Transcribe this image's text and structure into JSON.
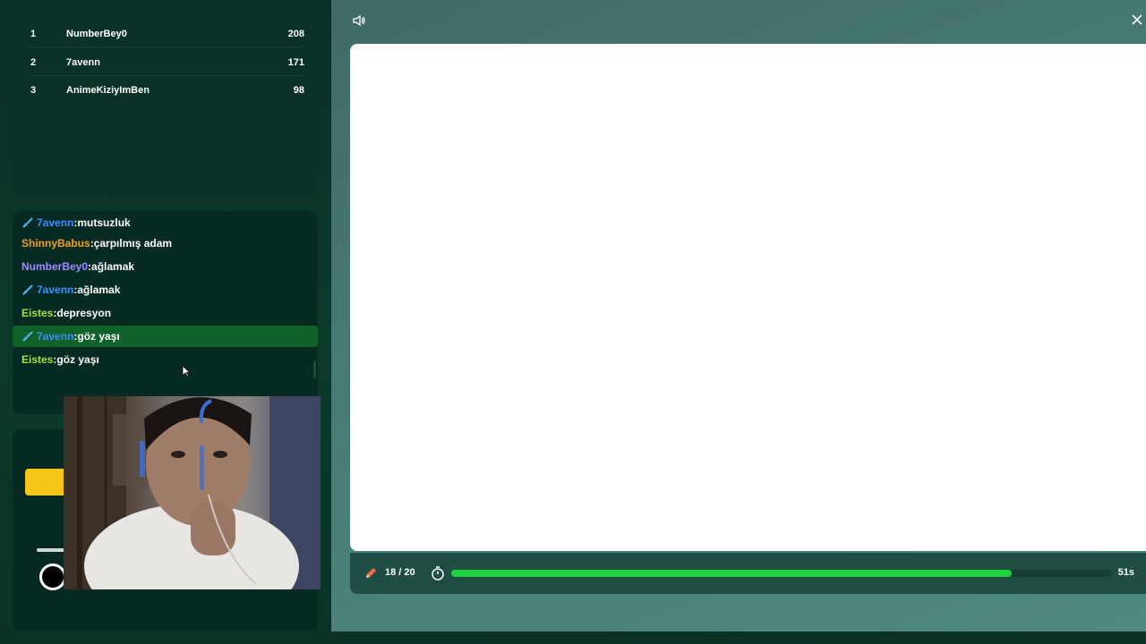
{
  "leaderboard": {
    "rows": [
      {
        "rank": "1",
        "name": "NumberBey0",
        "score": "208"
      },
      {
        "rank": "2",
        "name": "7avenn",
        "score": "171"
      },
      {
        "rank": "3",
        "name": "AnimeKiziyImBen",
        "score": "98"
      }
    ]
  },
  "chat": {
    "messages": [
      {
        "user": "7avenn",
        "sep": ":",
        "text": "mutsuzluk",
        "user_color": "#3a8dff",
        "badge": "sword-icon"
      },
      {
        "user": "ShinnyBabus",
        "sep": ":",
        "text": "çarpılmış adam",
        "user_color": "#f0a020",
        "badge": ""
      },
      {
        "user": "NumberBey0",
        "sep": ":",
        "text": "ağlamak",
        "user_color": "#9c8cff",
        "badge": ""
      },
      {
        "user": "7avenn",
        "sep": ":",
        "text": "ağlamak",
        "user_color": "#3a8dff",
        "badge": "sword-icon"
      },
      {
        "user": "Eistes",
        "sep": ":",
        "text": "depresyon",
        "user_color": "#a6e22e",
        "badge": ""
      },
      {
        "user": "7avenn",
        "sep": ":",
        "text": "göz yaşı",
        "user_color": "#3a8dff",
        "badge": "sword-icon",
        "highlight": true
      },
      {
        "user": "Eistes",
        "sep": ":",
        "text": "göz yaşı",
        "user_color": "#a6e22e",
        "badge": ""
      }
    ]
  },
  "game": {
    "round_current": 18,
    "round_total": 20,
    "round_label": "18 / 20",
    "timer_label": "51s",
    "timer_fraction": 0.85
  },
  "colors": {
    "accent_green": "#1fd13d",
    "highlight_green": "#10612a",
    "yellow": "#f5c518"
  }
}
